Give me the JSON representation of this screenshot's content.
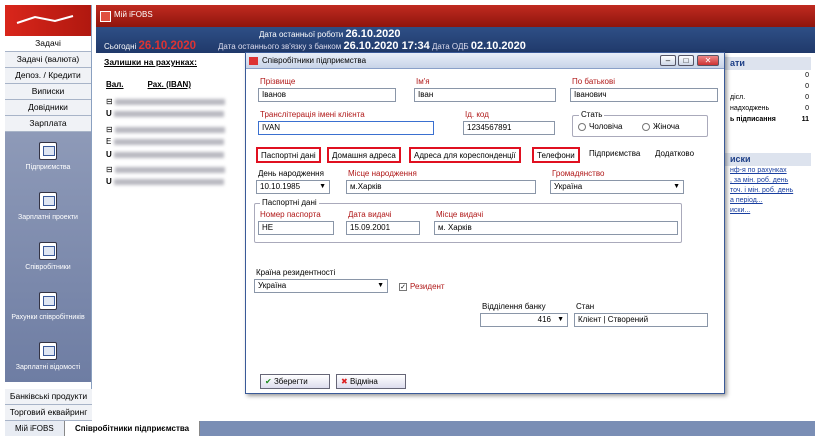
{
  "app": {
    "title": "Мій iFOBS"
  },
  "header": {
    "last_work_label": "Дата останньої роботи",
    "last_work_value": "26.10.2020",
    "today_label": "Сьогодні",
    "today_value": "26.10.2020",
    "last_conn_label": "Дата останнього зв'язку з банком",
    "last_conn_value": "26.10.2020 17:34",
    "odb_label": "Дата ОДБ",
    "odb_value": "02.10.2020"
  },
  "nav": {
    "items": [
      "Задачі",
      "Задачі (валюта)",
      "Депоз. / Кредити",
      "Виписки",
      "Довідники",
      "Зарплата"
    ],
    "modules": [
      "Підприємства",
      "Зарплатні проекти",
      "Співробітники",
      "Рахунки співробітників",
      "Зарплатні відомості"
    ],
    "bottom": [
      "Банківські продукти",
      "Торговий еквайринг"
    ]
  },
  "balances": {
    "title": "Залишки на рахунках:",
    "col_currency": "Вал.",
    "col_account": "Рах. (IBAN)",
    "rows": [
      "U",
      "E",
      "U",
      "U"
    ]
  },
  "right": {
    "title": "ати",
    "items": [
      {
        "label": "",
        "value": "0"
      },
      {
        "label": "",
        "value": "0"
      },
      {
        "label": "дісл.",
        "value": "0"
      },
      {
        "label": "надходжень",
        "value": "0"
      },
      {
        "label": "ь підписання",
        "value": "11"
      }
    ],
    "section2": "иски",
    "links": [
      "нф-я по рахунках",
      ", за мін. роб. день",
      "точ. і мін. роб. день",
      "а період...",
      "иски..."
    ]
  },
  "tabs": [
    {
      "label": "Мій iFOBS"
    },
    {
      "label": "Співробітники підприємства"
    }
  ],
  "dialog": {
    "title": "Співробітники підприємства",
    "surname_label": "Прізвище",
    "surname": "Іванов",
    "name_label": "Ім'я",
    "name": "Іван",
    "patronymic_label": "По батькові",
    "patronymic": "Іванович",
    "translit_label": "Транслітерація імені клієнта",
    "translit": "IVAN",
    "id_label": "Ід. код",
    "id_code": "1234567891",
    "sex_label": "Стать",
    "sex_male": "Чоловіча",
    "sex_female": "Жіноча",
    "tabs": [
      "Паспортні дані",
      "Домашня адреса",
      "Адреса для кореспонденції",
      "Телефони",
      "Підприємства",
      "Додатково"
    ],
    "birth_date_label": "День народження",
    "birth_date": "10.10.1985",
    "birth_place_label": "Місце народження",
    "birth_place": "м.Харків",
    "citizenship_label": "Громадянство",
    "citizenship": "Україна",
    "passport_group": "Паспортні дані",
    "passport_no_label": "Номер паспорта",
    "passport_no": "НЕ",
    "issue_date_label": "Дата видачі",
    "issue_date": "15.09.2001",
    "issue_place_label": "Місце видачі",
    "issue_place": "м. Харків",
    "residence_label": "Країна резидентності",
    "residence": "Україна",
    "resident_label": "Резидент",
    "branch_label": "Відділення банку",
    "branch": "416",
    "state_label": "Стан",
    "state": "Клієнт | Створений",
    "save_label": "Зберегти",
    "cancel_label": "Відміна"
  }
}
